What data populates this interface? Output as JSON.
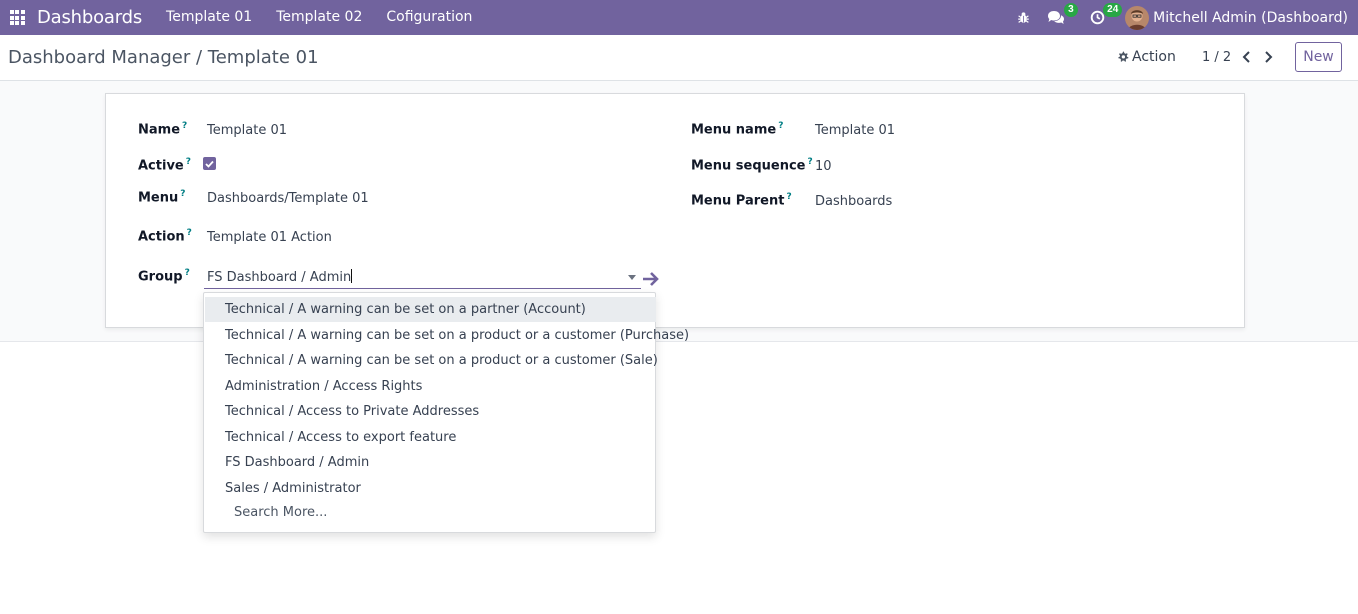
{
  "navbar": {
    "brand": "Dashboards",
    "menu": [
      "Template 01",
      "Template 02",
      "Cofiguration"
    ],
    "messages_badge": "3",
    "activities_badge": "24",
    "user": "Mitchell Admin (Dashboard)"
  },
  "control_panel": {
    "breadcrumb": "Dashboard Manager / Template 01",
    "action_label": "Action",
    "pager": "1 / 2",
    "new_label": "New"
  },
  "form": {
    "name_label": "Name",
    "name_value": "Template 01",
    "active_label": "Active",
    "active_checked": true,
    "menu_label": "Menu",
    "menu_value": "Dashboards/Template 01",
    "action_label": "Action",
    "action_value": "Template 01 Action",
    "group_label": "Group",
    "group_value": "FS Dashboard / Admin",
    "menu_name_label": "Menu name",
    "menu_name_value": "Template 01",
    "menu_sequence_label": "Menu sequence",
    "menu_sequence_value": "10",
    "menu_parent_label": "Menu Parent",
    "menu_parent_value": "Dashboards",
    "help_marker": "?"
  },
  "autocomplete": {
    "items": [
      "Technical / A warning can be set on a partner (Account)",
      "Technical / A warning can be set on a product or a customer (Purchase)",
      "Technical / A warning can be set on a product or a customer (Sale)",
      "Administration / Access Rights",
      "Technical / Access to Private Addresses",
      "Technical / Access to export feature",
      "FS Dashboard / Admin",
      "Sales / Administrator"
    ],
    "search_more": "Search More..."
  },
  "colors": {
    "brand": "#71639e",
    "badge": "#28a745",
    "help": "#017e84"
  }
}
